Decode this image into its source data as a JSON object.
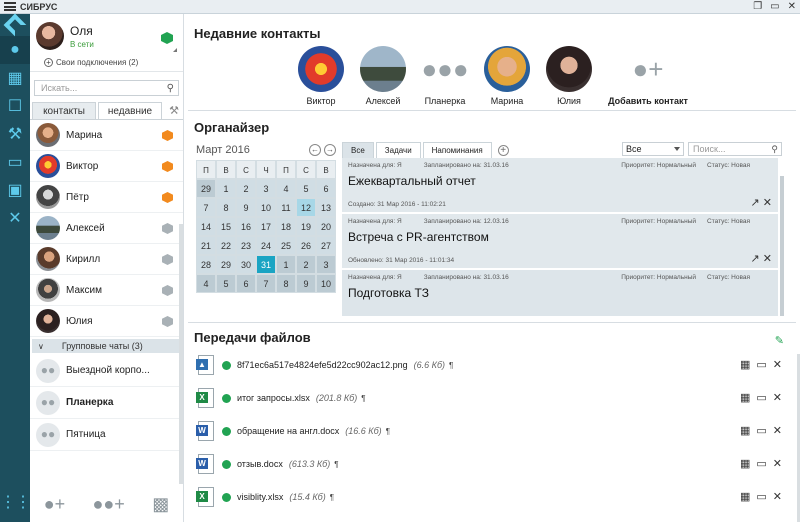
{
  "app": {
    "title": "СИБРУС"
  },
  "window_controls": [
    "❐",
    "▭",
    "✕"
  ],
  "rail": {
    "icons": [
      "person-icon",
      "keyboard-icon",
      "clipboard-icon",
      "wrench-icon",
      "folder-icon",
      "lock-icon",
      "tools-icon",
      "dialpad-icon"
    ]
  },
  "profile": {
    "name": "Оля",
    "status": "В сети",
    "connections": "Свои подключения (2)"
  },
  "search": {
    "placeholder": "Искать..."
  },
  "left_tabs": [
    "контакты",
    "недавние"
  ],
  "contacts": [
    {
      "name": "Марина",
      "badge": "orange"
    },
    {
      "name": "Виктор",
      "badge": "orange"
    },
    {
      "name": "Пётр",
      "badge": "orange"
    },
    {
      "name": "Алексей",
      "badge": "grey"
    },
    {
      "name": "Кирилл",
      "badge": "grey"
    },
    {
      "name": "Максим",
      "badge": "grey"
    },
    {
      "name": "Юлия",
      "badge": "grey"
    }
  ],
  "group_chats": {
    "header": "Групповые чаты (3)",
    "items": [
      "Выездной корпо...",
      "Планерка",
      "Пятница"
    ]
  },
  "recent": {
    "title": "Недавние контакты",
    "items": [
      "Виктор",
      "Алексей",
      "Планерка",
      "Марина",
      "Юлия"
    ],
    "add_label": "Добавить контакт"
  },
  "organizer": {
    "title": "Органайзер",
    "calendar": {
      "month": "Март",
      "year": "2016",
      "weekdays": [
        "П",
        "В",
        "С",
        "Ч",
        "П",
        "С",
        "В"
      ],
      "weeks": [
        [
          "29",
          "1",
          "2",
          "3",
          "4",
          "5",
          "6"
        ],
        [
          "7",
          "8",
          "9",
          "10",
          "11",
          "12",
          "13"
        ],
        [
          "14",
          "15",
          "16",
          "17",
          "18",
          "19",
          "20"
        ],
        [
          "21",
          "22",
          "23",
          "24",
          "25",
          "26",
          "27"
        ],
        [
          "28",
          "29",
          "30",
          "31",
          "1",
          "2",
          "3"
        ],
        [
          "4",
          "5",
          "6",
          "7",
          "8",
          "9",
          "10"
        ]
      ]
    },
    "tabs": [
      "Все",
      "Задачи",
      "Напоминания"
    ],
    "filter_value": "Все",
    "search_placeholder": "Поиск...",
    "tasks": [
      {
        "assigned": "Назначена для: Я",
        "planned": "Запланировано на: 31.03.16",
        "priority": "Приоритет: Нормальный",
        "status": "Статус: Новая",
        "title": "Ежеквартальный отчет",
        "created": "Создано: 31 Мар 2016 - 11:02:21"
      },
      {
        "assigned": "Назначена для: Я",
        "planned": "Запланировано на: 12.03.16",
        "priority": "Приоритет: Нормальный",
        "status": "Статус: Новая",
        "title": "Встреча с PR-агентством",
        "created": "Обновлено: 31 Мар 2016 - 11:01:34"
      },
      {
        "assigned": "Назначена для: Я",
        "planned": "Запланировано на: 31.03.16",
        "priority": "Приоритет: Нормальный",
        "status": "Статус: Новая",
        "title": "Подготовка ТЗ",
        "created": ""
      }
    ]
  },
  "files": {
    "title": "Передачи файлов",
    "items": [
      {
        "name": "8f71ec6a517e4824efe5d22cc902ac12.png",
        "size": "(6.6 Кб)",
        "type": "image"
      },
      {
        "name": "итог запросы.xlsx",
        "size": "(201.8 Кб)",
        "type": "excel"
      },
      {
        "name": "обращение на англ.docx",
        "size": "(16.6 Кб)",
        "type": "word"
      },
      {
        "name": "отзыв.docx",
        "size": "(613.3 Кб)",
        "type": "word"
      },
      {
        "name": "visiblity.xlsx",
        "size": "(15.4 Кб)",
        "type": "excel"
      }
    ]
  },
  "colors": {
    "rail": "#1d4f5e",
    "accent": "#1aa4c3",
    "online": "#21a352",
    "badge_orange": "#f28a1e"
  }
}
